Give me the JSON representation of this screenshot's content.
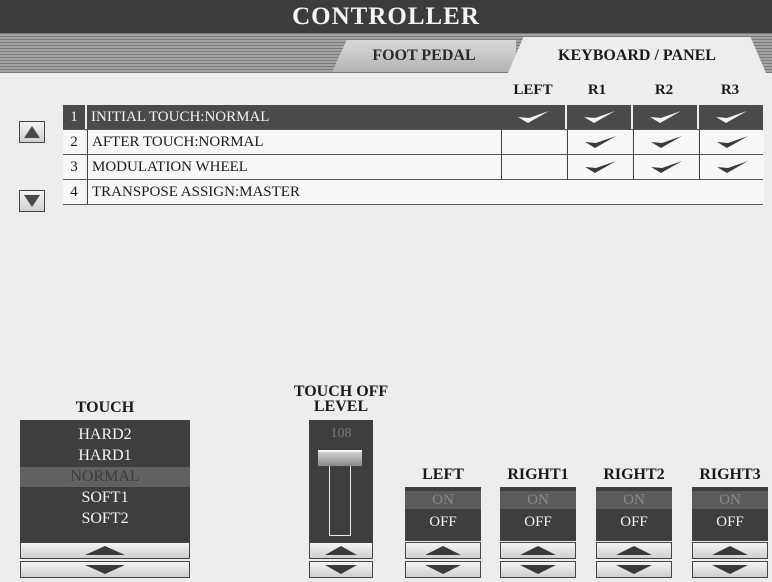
{
  "title": "CONTROLLER",
  "tabs": [
    {
      "label": "FOOT PEDAL",
      "active": false
    },
    {
      "label": "KEYBOARD / PANEL",
      "active": true
    }
  ],
  "columns": [
    "LEFT",
    "R1",
    "R2",
    "R3"
  ],
  "rows": [
    {
      "num": "1",
      "label": "INITIAL TOUCH:NORMAL",
      "checks": [
        true,
        true,
        true,
        true
      ],
      "selected": true
    },
    {
      "num": "2",
      "label": "AFTER TOUCH:NORMAL",
      "checks": [
        false,
        true,
        true,
        true
      ],
      "selected": false
    },
    {
      "num": "3",
      "label": "MODULATION WHEEL",
      "checks": [
        false,
        true,
        true,
        true
      ],
      "selected": false
    },
    {
      "num": "4",
      "label": "TRANSPOSE ASSIGN:MASTER",
      "checks": [],
      "selected": false
    }
  ],
  "touch": {
    "heading": "TOUCH",
    "options": [
      "HARD2",
      "HARD1",
      "NORMAL",
      "SOFT1",
      "SOFT2"
    ],
    "selected": "NORMAL"
  },
  "touch_off_level": {
    "heading_line1": "TOUCH OFF",
    "heading_line2": "LEVEL",
    "value": "108"
  },
  "parts": [
    {
      "name": "LEFT",
      "on": "ON",
      "off": "OFF",
      "state": "OFF"
    },
    {
      "name": "RIGHT1",
      "on": "ON",
      "off": "OFF",
      "state": "OFF"
    },
    {
      "name": "RIGHT2",
      "on": "ON",
      "off": "OFF",
      "state": "OFF"
    },
    {
      "name": "RIGHT3",
      "on": "ON",
      "off": "OFF",
      "state": "OFF"
    }
  ],
  "icons": {
    "scroll_up": "triangle-up-icon",
    "scroll_down": "triangle-down-icon",
    "check": "checkmark-icon"
  }
}
